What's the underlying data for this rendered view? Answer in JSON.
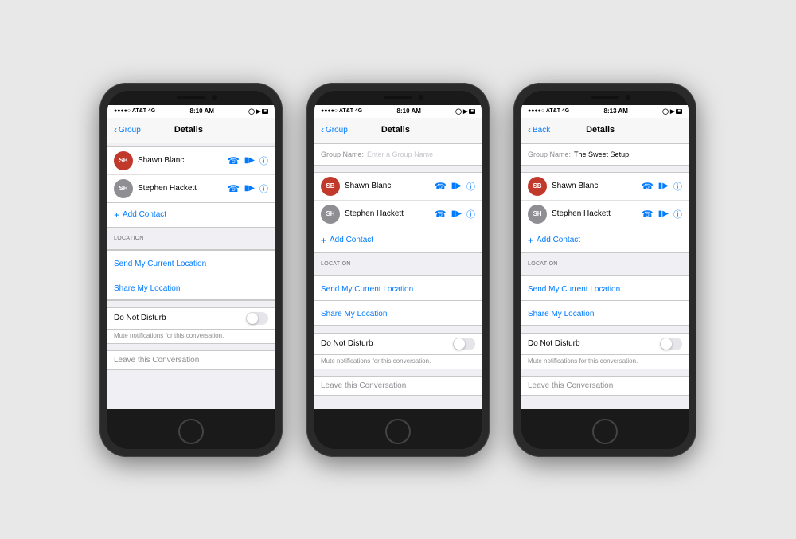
{
  "phones": [
    {
      "id": "phone1",
      "status_bar": {
        "carrier": "●●●●○ AT&T 4G",
        "time": "8:10 AM",
        "icons": "⊙ ▶ ■"
      },
      "nav": {
        "back_label": "Group",
        "title": "Details",
        "right": ""
      },
      "group_name": {
        "show": false,
        "label": "",
        "value": "",
        "placeholder": ""
      },
      "contacts": [
        {
          "initials": "SB",
          "name": "Shawn Blanc",
          "avatar_color": "#c0392b"
        },
        {
          "initials": "SH",
          "name": "Stephen Hackett",
          "avatar_color": "#8e8e93"
        }
      ],
      "add_contact_label": "Add Contact",
      "location_header": "LOCATION",
      "location_items": [
        "Send My Current Location",
        "Share My Location"
      ],
      "dnd_label": "Do Not Disturb",
      "dnd_sub": "Mute notifications for this conversation.",
      "leave_label": "Leave this Conversation"
    },
    {
      "id": "phone2",
      "status_bar": {
        "carrier": "●●●●○ AT&T 4G",
        "time": "8:10 AM",
        "icons": "⊙ ▶ ■"
      },
      "nav": {
        "back_label": "Group",
        "title": "Details",
        "right": ""
      },
      "group_name": {
        "show": true,
        "label": "Group Name:",
        "value": "",
        "placeholder": "Enter a Group Name"
      },
      "contacts": [
        {
          "initials": "SB",
          "name": "Shawn Blanc",
          "avatar_color": "#c0392b"
        },
        {
          "initials": "SH",
          "name": "Stephen Hackett",
          "avatar_color": "#8e8e93"
        }
      ],
      "add_contact_label": "Add Contact",
      "location_header": "LOCATION",
      "location_items": [
        "Send My Current Location",
        "Share My Location"
      ],
      "dnd_label": "Do Not Disturb",
      "dnd_sub": "Mute notifications for this conversation.",
      "leave_label": "Leave this Conversation"
    },
    {
      "id": "phone3",
      "status_bar": {
        "carrier": "●●●●○ AT&T 4G",
        "time": "8:13 AM",
        "icons": "⊙ ▶ ■"
      },
      "nav": {
        "back_label": "Back",
        "title": "Details",
        "right": ""
      },
      "group_name": {
        "show": true,
        "label": "Group Name:",
        "value": "The Sweet Setup",
        "placeholder": ""
      },
      "contacts": [
        {
          "initials": "SB",
          "name": "Shawn Blanc",
          "avatar_color": "#c0392b"
        },
        {
          "initials": "SH",
          "name": "Stephen Hackett",
          "avatar_color": "#8e8e93"
        }
      ],
      "add_contact_label": "Add Contact",
      "location_header": "LOCATION",
      "location_items": [
        "Send My Current Location",
        "Share My Location"
      ],
      "dnd_label": "Do Not Disturb",
      "dnd_sub": "Mute notifications for this conversation.",
      "leave_label": "Leave this Conversation"
    }
  ]
}
